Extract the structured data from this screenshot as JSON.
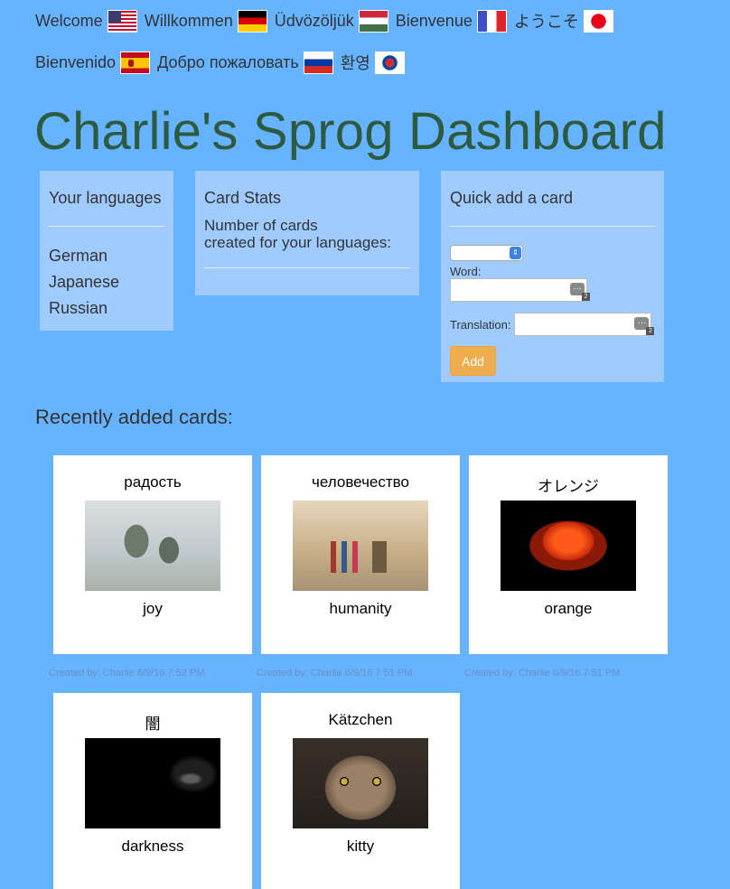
{
  "greetings": [
    [
      {
        "word": "Welcome",
        "flag": "us-flag"
      },
      {
        "word": "Willkommen",
        "flag": "german-flag"
      },
      {
        "word": "Üdvözöljük",
        "flag": "hungarian-flag"
      },
      {
        "word": "Bienvenue",
        "flag": "french-flag"
      },
      {
        "word": "ようこそ",
        "flag": "japanese-flag"
      }
    ],
    [
      {
        "word": "Bienvenido",
        "flag": "spanish-flag"
      },
      {
        "word": "Добро пожаловать",
        "flag": "russian-flag"
      },
      {
        "word": "환영",
        "flag": "korean-flag"
      }
    ]
  ],
  "title": "Charlie's Sprog Dashboard",
  "languages_panel": {
    "heading": "Your languages",
    "items": [
      "German",
      "Japanese",
      "Russian"
    ]
  },
  "stats_panel": {
    "heading": "Card Stats",
    "line1": "Number of cards",
    "line2": "created for your languages:"
  },
  "quick_add": {
    "heading": "Quick add a card",
    "language_select_value": "",
    "word_label": "Word:",
    "word_value": "",
    "translation_label": "Translation:",
    "translation_value": "",
    "password_badge": "2",
    "add_label": "Add"
  },
  "recent_heading": "Recently added cards:",
  "cards": [
    {
      "word": "радость",
      "translation": "joy",
      "image": "joy-statue-image",
      "credit": "Created by: Charlie 6/9/16 7:52 PM"
    },
    {
      "word": "человечество",
      "translation": "humanity",
      "image": "humanity-photo-image",
      "credit": "Created by: Charlie 6/9/16 7:51 PM"
    },
    {
      "word": "オレンジ",
      "translation": "orange",
      "image": "orange-rose-image",
      "credit": "Created by: Charlie 6/9/16 7:51 PM"
    },
    {
      "word": "闇",
      "translation": "darkness",
      "image": "darkness-image",
      "credit": ""
    },
    {
      "word": "Kätzchen",
      "translation": "kitty",
      "image": "kitten-image",
      "credit": ""
    }
  ]
}
